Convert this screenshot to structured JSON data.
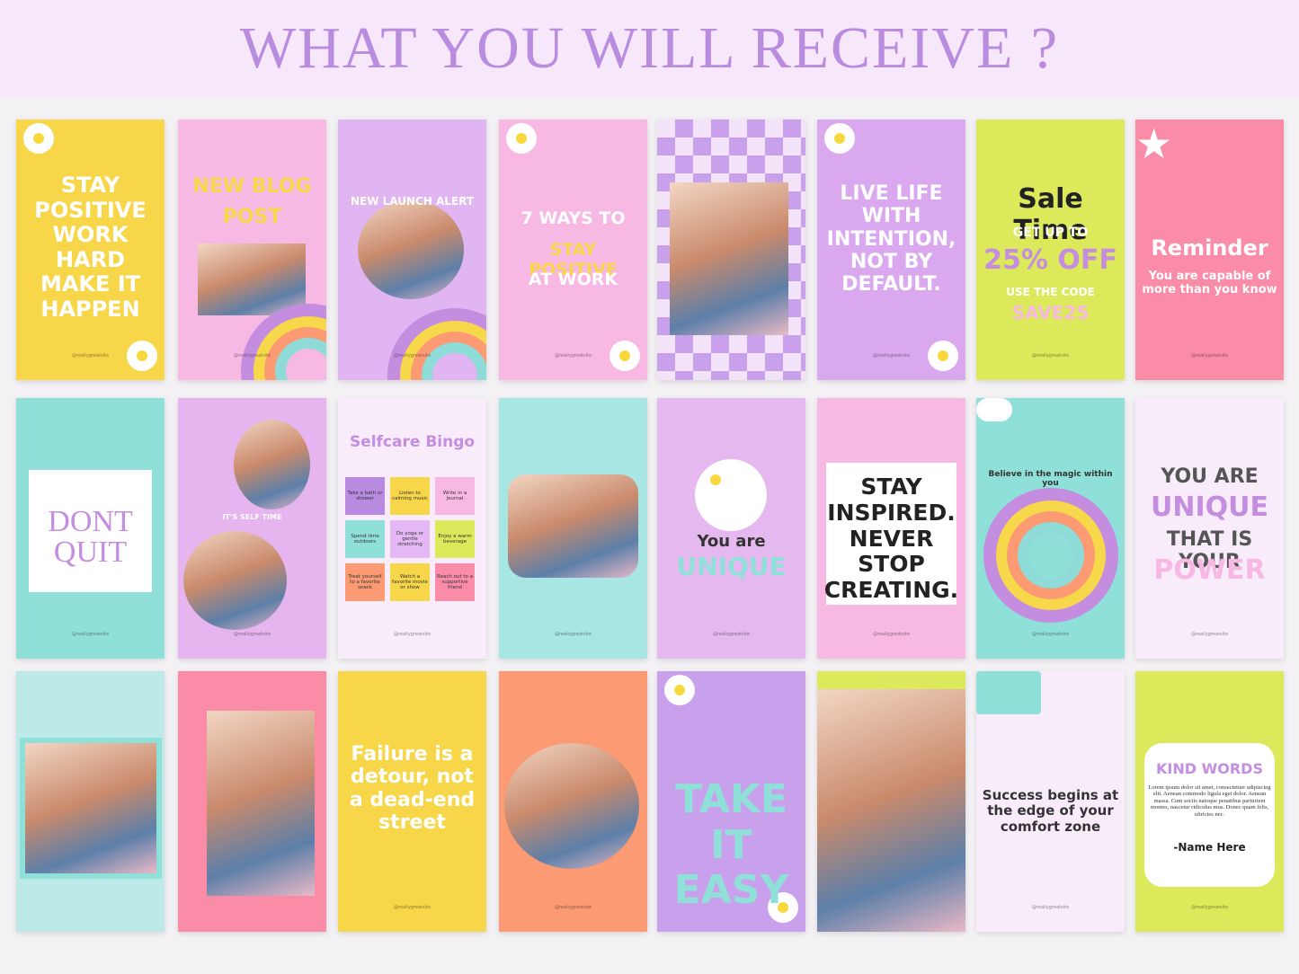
{
  "header": {
    "title": "WHAT YOU WILL RECEIVE ?"
  },
  "handle": "@reallygreatsite",
  "cards": [
    {
      "bg": "#f7d64a",
      "lines": [
        {
          "t": "STAY POSITIVE WORK HARD MAKE IT HAPPEN",
          "c": "#ffffff"
        }
      ],
      "deco": "flower"
    },
    {
      "bg": "#f7b8e3",
      "lines": [
        {
          "t": "NEW BLOG",
          "c": "#f7d64a"
        },
        {
          "t": "POST",
          "c": "#f7d64a"
        }
      ],
      "deco": "photo-rainbow"
    },
    {
      "bg": "#e0b5f2",
      "lines": [
        {
          "t": "NEW LAUNCH ALERT",
          "c": "#ffffff"
        }
      ],
      "deco": "photo-round-rainbow"
    },
    {
      "bg": "#f7b8e3",
      "lines": [
        {
          "t": "7 WAYS TO",
          "c": "#ffffff"
        },
        {
          "t": "STAY POSITIVE",
          "c": "#f7d64a"
        },
        {
          "t": "AT WORK",
          "c": "#ffffff"
        }
      ],
      "deco": "flower"
    },
    {
      "bg": "#e3b8f4",
      "lines": [],
      "deco": "photo-check"
    },
    {
      "bg": "#d9a8ef",
      "lines": [
        {
          "t": "LIVE LIFE WITH INTENTION, NOT BY DEFAULT.",
          "c": "#ffffff"
        }
      ],
      "deco": "flower"
    },
    {
      "bg": "#dbe95a",
      "lines": [
        {
          "t": "Sale Time",
          "c": "#222222"
        },
        {
          "t": "GET UP TO",
          "c": "#ffffff"
        },
        {
          "t": "25% OFF",
          "c": "#c48de0"
        },
        {
          "t": "USE THE CODE",
          "c": "#ffffff"
        },
        {
          "t": "SAVE25",
          "c": "#f7b8e3"
        }
      ],
      "deco": "none"
    },
    {
      "bg": "#fb8ca8",
      "lines": [
        {
          "t": "Reminder",
          "c": "#ffffff"
        },
        {
          "t": "You are capable of more than you know",
          "c": "#ffffff"
        }
      ],
      "deco": "star"
    },
    {
      "bg": "#8fe0d9",
      "lines": [
        {
          "t": "DONT",
          "c": "#c48de0"
        },
        {
          "t": "QUIT",
          "c": "#c48de0"
        }
      ],
      "deco": "panel"
    },
    {
      "bg": "#e6b4ee",
      "lines": [
        {
          "t": "IT'S SELF TIME",
          "c": "#ffffff"
        }
      ],
      "deco": "photo-two"
    },
    {
      "bg": "#f8ecfb",
      "lines": [
        {
          "t": "Selfcare Bingo",
          "c": "#c48de0"
        }
      ],
      "bingo": [
        {
          "t": "Take a bath or shower",
          "c": "#b88be0"
        },
        {
          "t": "Listen to calming music",
          "c": "#f7d64a"
        },
        {
          "t": "Write in a journal",
          "c": "#f7b8e3"
        },
        {
          "t": "Spend time outdoors",
          "c": "#8fe0d9"
        },
        {
          "t": "Do yoga or gentle stretching",
          "c": "#e3b8f4"
        },
        {
          "t": "Enjoy a warm beverage",
          "c": "#dbe95a"
        },
        {
          "t": "Treat yourself to a favorite snack",
          "c": "#fb9a73"
        },
        {
          "t": "Watch a favorite movie or show",
          "c": "#f7d64a"
        },
        {
          "t": "Reach out to a supportive friend",
          "c": "#fb8ca8"
        }
      ],
      "deco": "bingo"
    },
    {
      "bg": "#a8e6e4",
      "lines": [],
      "deco": "photo-big"
    },
    {
      "bg": "#e6b8f0",
      "lines": [
        {
          "t": "You are",
          "c": "#333333"
        },
        {
          "t": "UNIQUE",
          "c": "#8fe0d9"
        }
      ],
      "deco": "flower-big"
    },
    {
      "bg": "#f7b8e3",
      "lines": [
        {
          "t": "STAY INSPIRED. NEVER STOP CREATING.",
          "c": "#222222"
        }
      ],
      "deco": "panel"
    },
    {
      "bg": "#8fe0d9",
      "lines": [
        {
          "t": "Believe in the magic within you",
          "c": "#333333"
        }
      ],
      "deco": "rainbow"
    },
    {
      "bg": "#f8ecfb",
      "lines": [
        {
          "t": "YOU ARE",
          "c": "#555555"
        },
        {
          "t": "UNIQUE",
          "c": "#c48de0"
        },
        {
          "t": "THAT IS YOUR",
          "c": "#555555"
        },
        {
          "t": "POWER",
          "c": "#f7b8e3"
        }
      ],
      "deco": "none"
    },
    {
      "bg": "#bdeae8",
      "lines": [],
      "deco": "photo-frame"
    },
    {
      "bg": "#fb8ca8",
      "lines": [],
      "deco": "photo-big"
    },
    {
      "bg": "#f7d64a",
      "lines": [
        {
          "t": "Failure is a detour, not a dead-end street",
          "c": "#ffffff"
        }
      ],
      "deco": "none"
    },
    {
      "bg": "#fb9a73",
      "lines": [],
      "deco": "photo-round"
    },
    {
      "bg": "#c9a0ec",
      "lines": [
        {
          "t": "TAKE IT EASY",
          "c": "#8fe0d9"
        }
      ],
      "deco": "flower"
    },
    {
      "bg": "#dbe95a",
      "lines": [],
      "deco": "photo-full"
    },
    {
      "bg": "#f8ecfb",
      "lines": [
        {
          "t": "Success begins at the edge of your comfort zone",
          "c": "#333333"
        }
      ],
      "deco": "envelope"
    },
    {
      "bg": "#dbe95a",
      "lines": [
        {
          "t": "KIND WORDS",
          "c": "#c48de0"
        },
        {
          "t": "Lorem ipsum dolor sit amet, consectetuer adipiscing elit. Aenean commodo ligula eget dolor. Aenean massa. Cum sociis natoque penatibus parturient montes, nascetur ridiculus mus. Donec quam felis, ultricies nec.",
          "c": "#333333"
        },
        {
          "t": "-Name Here",
          "c": "#222222"
        }
      ],
      "deco": "panel"
    }
  ]
}
